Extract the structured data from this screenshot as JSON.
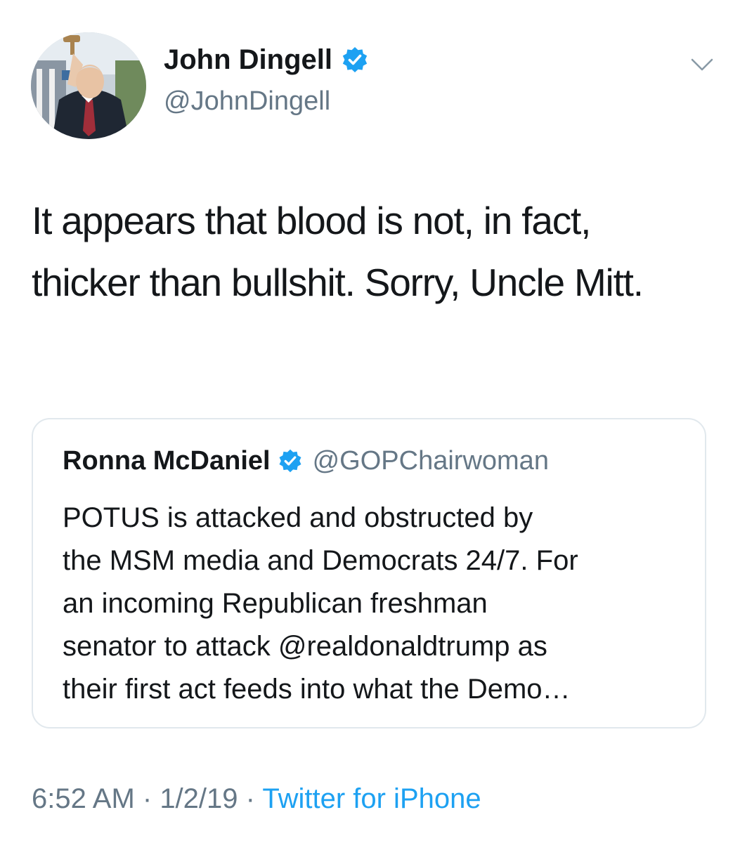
{
  "tweet": {
    "author": {
      "name": "John Dingell",
      "handle": "@JohnDingell",
      "verified": true,
      "avatar": "profile-photo"
    },
    "menu_icon": "chevron-down-icon",
    "text": "It appears that blood is not, in fact, thicker than bullshit. Sorry, Uncle Mitt.",
    "quoted": {
      "name": "Ronna McDaniel",
      "handle": "@GOPChairwoman",
      "verified": true,
      "text": "POTUS is attacked and obstructed by\nthe MSM media and Democrats 24/7. For\nan incoming Republican freshman\nsenator to attack @realdonaldtrump as\ntheir first act feeds into what the Demo…"
    },
    "meta": {
      "time": "6:52 AM",
      "separator": " · ",
      "date": "1/2/19",
      "source": "Twitter for iPhone"
    }
  },
  "colors": {
    "text": "#14171a",
    "secondary": "#657786",
    "link": "#1da1f2",
    "border": "#e1e8ed",
    "verified": "#1da1f2"
  }
}
